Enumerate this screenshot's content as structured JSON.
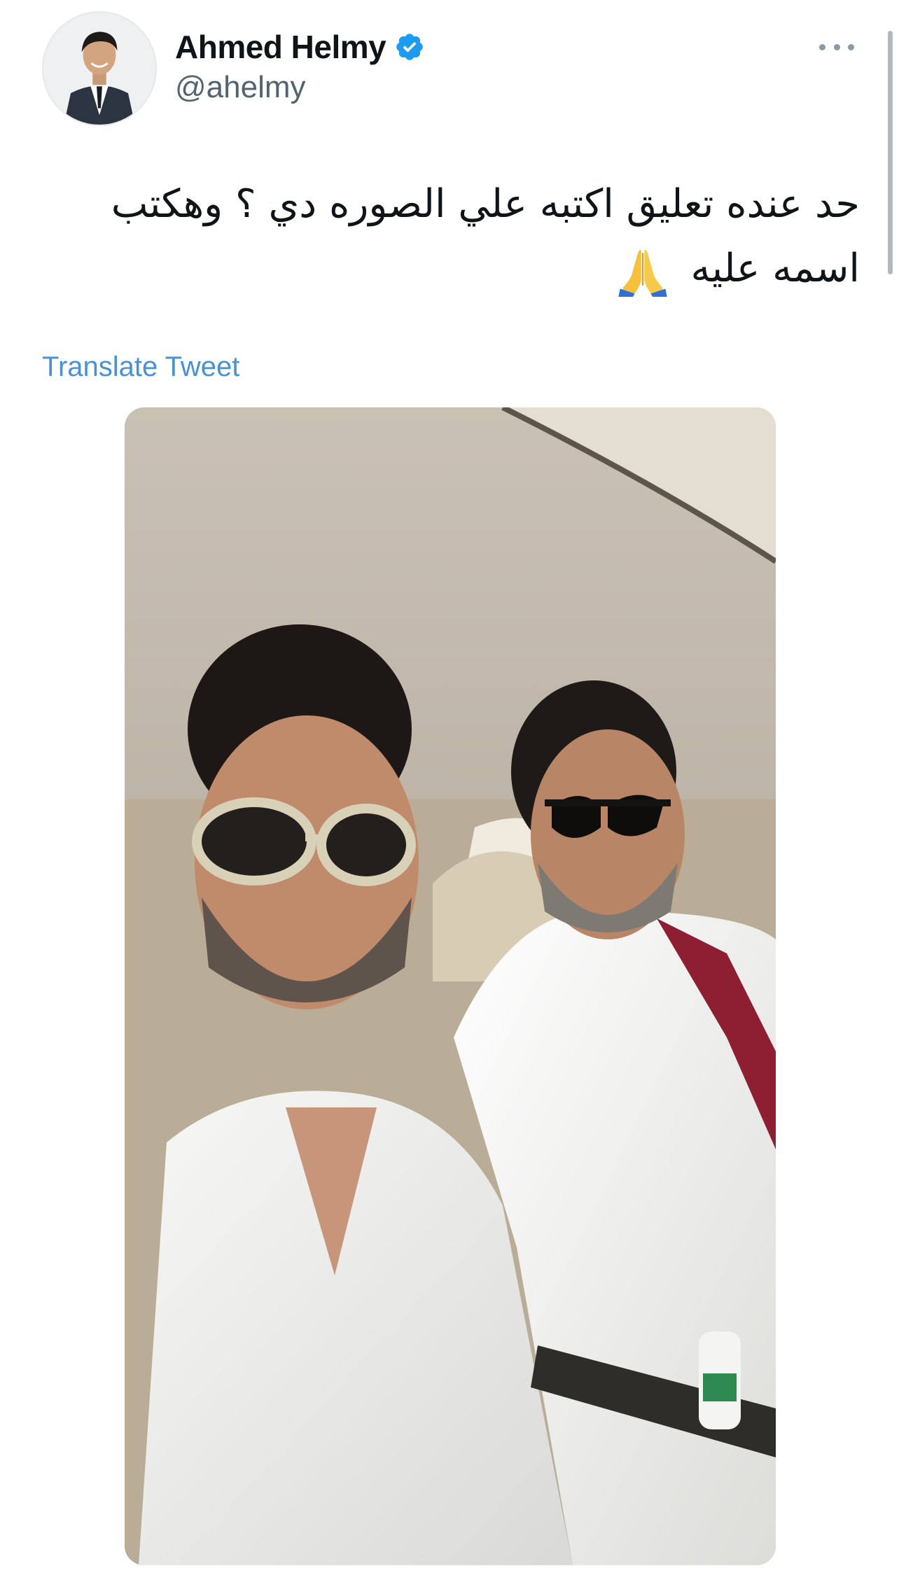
{
  "tweet": {
    "author": {
      "display_name": "Ahmed Helmy",
      "handle": "@ahelmy",
      "verified_icon": "verified-badge-icon",
      "avatar_icon": "avatar"
    },
    "menu_icon": "more-options-icon",
    "text": "حد عنده تعليق اكتبه علي الصوره دي ؟ وهكتب اسمه عليه",
    "emoji": "🙏",
    "emoji_icon": "folded-hands-icon",
    "translate_label": "Translate Tweet",
    "media": {
      "type": "photo",
      "icon": "photo"
    }
  },
  "colors": {
    "text": "#0f1419",
    "secondary": "#536471",
    "link": "#4a90d6",
    "verified": "#1d9bf0",
    "background": "#ffffff"
  }
}
